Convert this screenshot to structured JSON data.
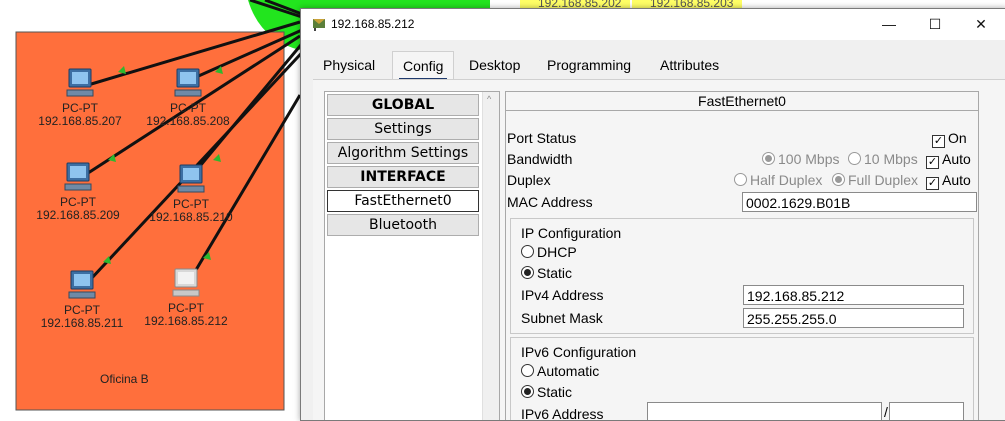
{
  "topology": {
    "top_ips": [
      "192.168.85.202",
      "192.168.85.203"
    ],
    "office_label": "Oficina B",
    "pcs": [
      {
        "name": "PC-PT",
        "ip": "192.168.85.207"
      },
      {
        "name": "PC-PT",
        "ip": "192.168.85.208"
      },
      {
        "name": "PC-PT",
        "ip": "192.168.85.209"
      },
      {
        "name": "PC-PT",
        "ip": "192.168.85.210"
      },
      {
        "name": "PC-PT",
        "ip": "192.168.85.211"
      },
      {
        "name": "PC-PT",
        "ip": "192.168.85.212"
      }
    ],
    "colors": {
      "office_fill": "#ff6f3c",
      "switch_area": "#22e51e",
      "ip_tag_bg": "#ffff66",
      "link": "#111111",
      "link_marker": "#2eb82e"
    }
  },
  "window": {
    "title": "192.168.85.212",
    "buttons": {
      "minimize": "—",
      "maximize": "☐",
      "close": "✕"
    },
    "tabs": [
      {
        "label": "Physical"
      },
      {
        "label": "Config"
      },
      {
        "label": "Desktop"
      },
      {
        "label": "Programming"
      },
      {
        "label": "Attributes"
      }
    ],
    "active_tab": "Config"
  },
  "left_panel": {
    "items": [
      {
        "label": "GLOBAL"
      },
      {
        "label": "Settings"
      },
      {
        "label": "Algorithm Settings"
      },
      {
        "label": "INTERFACE"
      },
      {
        "label": "FastEthernet0"
      },
      {
        "label": "Bluetooth"
      }
    ],
    "scroll_up": "^"
  },
  "interface": {
    "header": "FastEthernet0",
    "port_status_label": "Port Status",
    "port_on_label": "On",
    "port_on_checked": true,
    "bandwidth_label": "Bandwidth",
    "bw_100": "100 Mbps",
    "bw_10": "10 Mbps",
    "bw_auto": "Auto",
    "duplex_label": "Duplex",
    "half_duplex": "Half Duplex",
    "full_duplex": "Full Duplex",
    "duplex_auto": "Auto",
    "mac_label": "MAC Address",
    "mac_value": "0002.1629.B01B",
    "ip_config_label": "IP Configuration",
    "dhcp_label": "DHCP",
    "static_label": "Static",
    "ipv4_label": "IPv4 Address",
    "ipv4_value": "192.168.85.212",
    "mask_label": "Subnet Mask",
    "mask_value": "255.255.255.0",
    "ipv6_config_label": "IPv6 Configuration",
    "automatic_label": "Automatic",
    "static6_label": "Static",
    "ipv6_addr_label": "IPv6 Address",
    "ipv6_value": "",
    "ipv6_prefix": "",
    "ipv6_sep": "/"
  }
}
